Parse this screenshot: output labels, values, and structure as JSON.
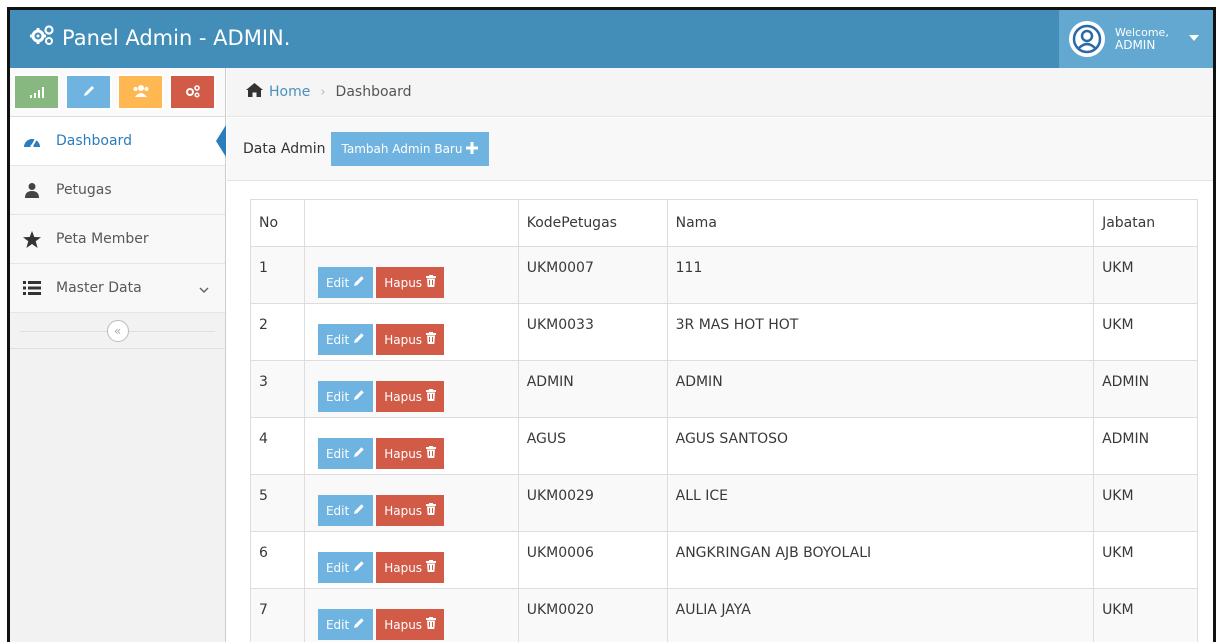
{
  "navbar": {
    "brand": "Panel Admin - ADMIN.",
    "welcome_label": "Welcome,",
    "username": "ADMIN"
  },
  "sidebar": {
    "shortcuts": [
      {
        "icon": "signal-icon",
        "color": "#87b87f"
      },
      {
        "icon": "pencil-icon",
        "color": "#6fb3e0"
      },
      {
        "icon": "group-icon",
        "color": "#ffb752"
      },
      {
        "icon": "cogs-icon",
        "color": "#d15b47"
      }
    ],
    "items": [
      {
        "label": "Dashboard",
        "icon": "tachometer-icon",
        "active": true
      },
      {
        "label": "Petugas",
        "icon": "user-icon"
      },
      {
        "label": "Peta Member",
        "icon": "star-icon"
      },
      {
        "label": "Master Data",
        "icon": "list-icon",
        "has_submenu": true
      }
    ],
    "collapse_icon": "double-angle-left-icon"
  },
  "breadcrumb": {
    "home": "Home",
    "current": "Dashboard"
  },
  "page_header": {
    "title": "Data Admin",
    "add_button": "Tambah Admin Baru"
  },
  "table": {
    "columns": [
      "No",
      "",
      "KodePetugas",
      "Nama",
      "Jabatan"
    ],
    "edit_label": "Edit",
    "delete_label": "Hapus",
    "rows": [
      {
        "no": "1",
        "kode": "UKM0007",
        "nama": "111",
        "jabatan": "UKM"
      },
      {
        "no": "2",
        "kode": "UKM0033",
        "nama": "3R MAS HOT HOT",
        "jabatan": "UKM"
      },
      {
        "no": "3",
        "kode": "ADMIN",
        "nama": "ADMIN",
        "jabatan": "ADMIN"
      },
      {
        "no": "4",
        "kode": "AGUS",
        "nama": "AGUS SANTOSO",
        "jabatan": "ADMIN"
      },
      {
        "no": "5",
        "kode": "UKM0029",
        "nama": "ALL ICE",
        "jabatan": "UKM"
      },
      {
        "no": "6",
        "kode": "UKM0006",
        "nama": "ANGKRINGAN AJB BOYOLALI",
        "jabatan": "UKM"
      },
      {
        "no": "7",
        "kode": "UKM0020",
        "nama": "AULIA JAYA",
        "jabatan": "UKM"
      }
    ]
  },
  "colors": {
    "navbar": "#438eb9",
    "user_menu": "#62a8d1",
    "primary_button": "#6fb3e0",
    "danger_button": "#d15b47",
    "active_nav": "#2b7dbc"
  }
}
